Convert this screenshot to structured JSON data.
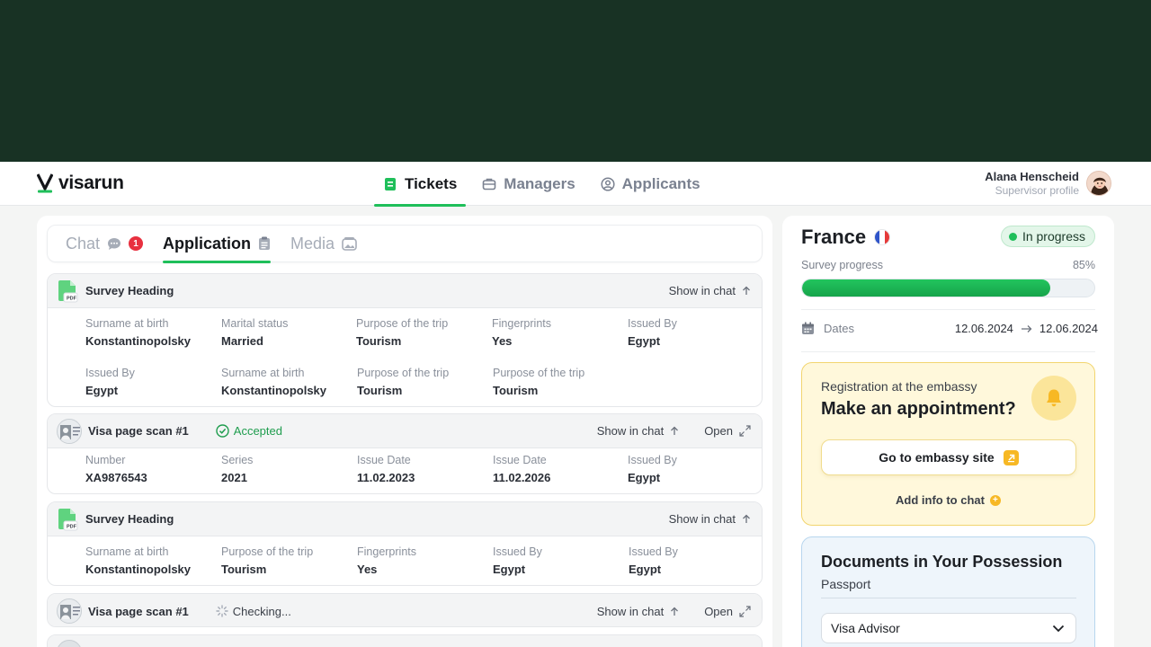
{
  "app": {
    "brand": "visarun",
    "accent": "#1fbf5a",
    "hero_color": "#183224"
  },
  "nav": {
    "items": [
      {
        "label": "Tickets",
        "icon": "ticket-icon",
        "active": true
      },
      {
        "label": "Managers",
        "icon": "briefcase-icon",
        "active": false
      },
      {
        "label": "Applicants",
        "icon": "user-circle-icon",
        "active": false
      }
    ]
  },
  "profile": {
    "name": "Alana Henscheid",
    "role": "Supervisor profile"
  },
  "tabs": [
    {
      "label": "Chat",
      "icon": "chat-bubble-icon",
      "badge": "1"
    },
    {
      "label": "Application",
      "icon": "clipboard-icon",
      "active": true
    },
    {
      "label": "Media",
      "icon": "images-icon"
    }
  ],
  "cards": [
    {
      "title": "Survey Heading",
      "icon": "pdf-file-icon",
      "action": "Show in chat",
      "fields": [
        {
          "label": "Surname at birth",
          "value": "Konstantinopolsky"
        },
        {
          "label": "Marital status",
          "value": "Married"
        },
        {
          "label": "Purpose of the trip",
          "value": "Tourism"
        },
        {
          "label": "Fingerprints",
          "value": "Yes"
        },
        {
          "label": "Issued By",
          "value": "Egypt"
        },
        {
          "label": "Issued By",
          "value": "Egypt"
        },
        {
          "label": "Surname at birth",
          "value": "Konstantinopolsky"
        },
        {
          "label": "Purpose of the trip",
          "value": "Tourism"
        },
        {
          "label": "Purpose of the trip",
          "value": "Tourism"
        }
      ]
    },
    {
      "title": "Visa page scan #1",
      "icon": "passport-photo-icon",
      "status": "Accepted",
      "action": "Show in chat",
      "open": "Open",
      "fields": [
        {
          "label": "Number",
          "value": "XA9876543"
        },
        {
          "label": "Series",
          "value": "2021"
        },
        {
          "label": "Issue Date",
          "value": "11.02.2023"
        },
        {
          "label": "Issue Date",
          "value": "11.02.2026"
        },
        {
          "label": "Issued By",
          "value": "Egypt"
        }
      ]
    },
    {
      "title": "Survey Heading",
      "icon": "pdf-file-icon",
      "action": "Show in chat",
      "fields": [
        {
          "label": "Surname at birth",
          "value": "Konstantinopolsky"
        },
        {
          "label": "Purpose of the trip",
          "value": "Tourism"
        },
        {
          "label": "Fingerprints",
          "value": "Yes"
        },
        {
          "label": "Issued By",
          "value": "Egypt"
        },
        {
          "label": "Issued By",
          "value": "Egypt"
        }
      ]
    },
    {
      "title": "Visa page scan #1",
      "icon": "passport-photo-icon",
      "status": "Checking...",
      "action": "Show in chat",
      "open": "Open"
    }
  ],
  "sidebar": {
    "country": "France",
    "flag": "france-flag-icon",
    "status": "In progress",
    "progress_label": "Survey progress",
    "progress_text": "85%",
    "progress": 0.85,
    "dates_label": "Dates",
    "date_from": "12.06.2024",
    "date_to": "12.06.2024",
    "appointment": {
      "subtitle": "Registration at the embassy",
      "title": "Make an appointment?",
      "button": "Go to embassy site",
      "add_info": "Add info to chat"
    },
    "documents": {
      "title": "Documents in Your Possession",
      "subtitle": "Passport",
      "select_value": "Visa Advisor"
    }
  }
}
